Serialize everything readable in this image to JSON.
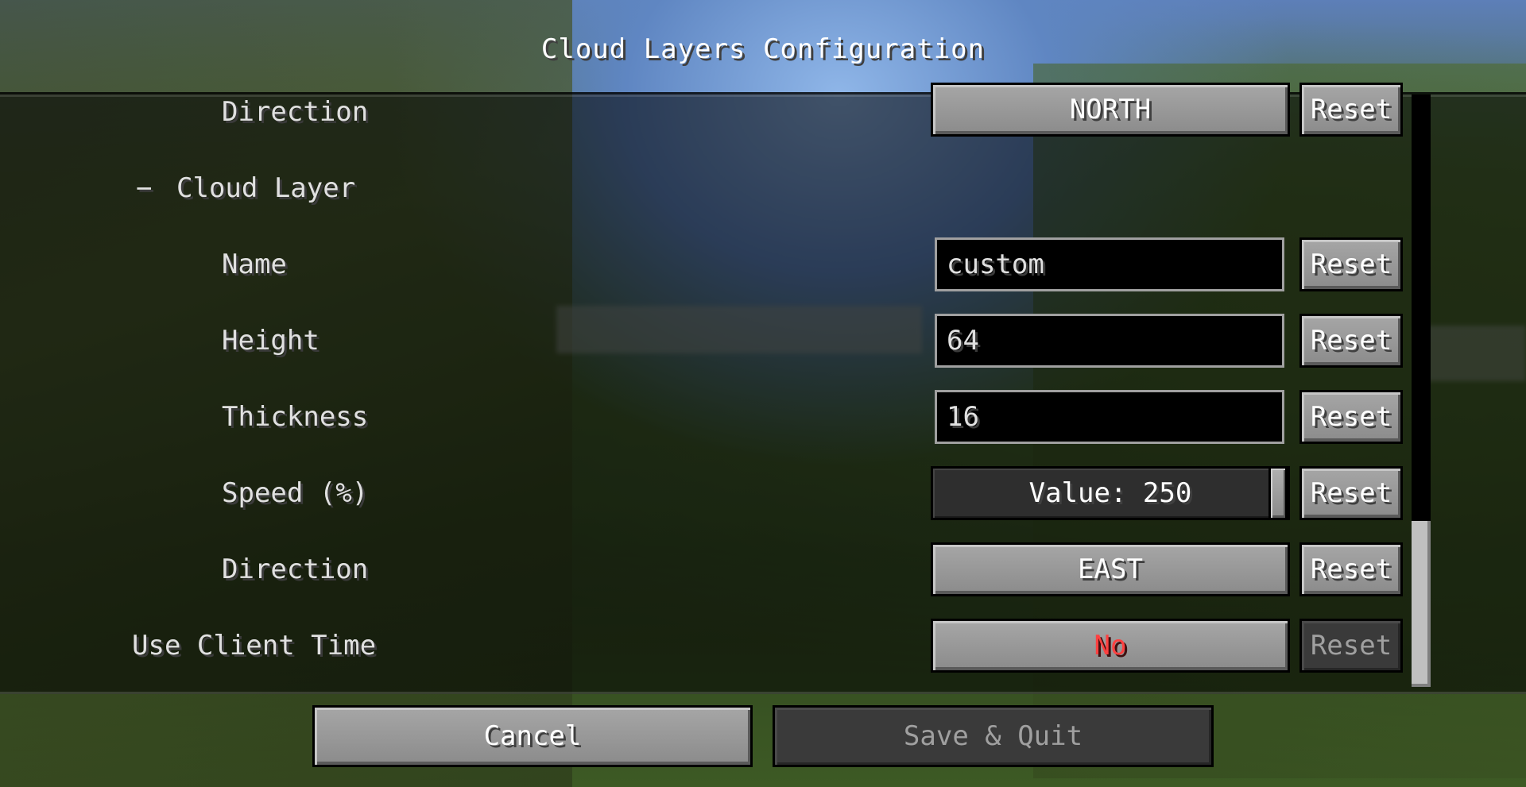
{
  "screen": {
    "title": "Cloud Layers Configuration"
  },
  "entries": [
    {
      "label": "Direction",
      "control": "button",
      "value": "NORTH",
      "reset": "Reset",
      "reset_enabled": true
    },
    {
      "label": "Cloud Layer",
      "toggle": "−",
      "control": "category"
    },
    {
      "label": "Name",
      "control": "text",
      "value": "custom",
      "reset": "Reset",
      "reset_enabled": true
    },
    {
      "label": "Height",
      "control": "text",
      "value": "64",
      "reset": "Reset",
      "reset_enabled": true
    },
    {
      "label": "Thickness",
      "control": "text",
      "value": "16",
      "reset": "Reset",
      "reset_enabled": true
    },
    {
      "label": "Speed (%)",
      "control": "slider",
      "value": "Value: 250",
      "reset": "Reset",
      "reset_enabled": true
    },
    {
      "label": "Direction",
      "control": "button",
      "value": "EAST",
      "reset": "Reset",
      "reset_enabled": true
    },
    {
      "label": "Use Client Time",
      "control": "button",
      "value": "No",
      "value_color": "#ff4040",
      "reset": "Reset",
      "reset_enabled": false
    }
  ],
  "footer": {
    "cancel_label": "Cancel",
    "save_label": "Save & Quit"
  },
  "scroll": {
    "position_fraction": 1.0,
    "visible_fraction": 0.28
  }
}
